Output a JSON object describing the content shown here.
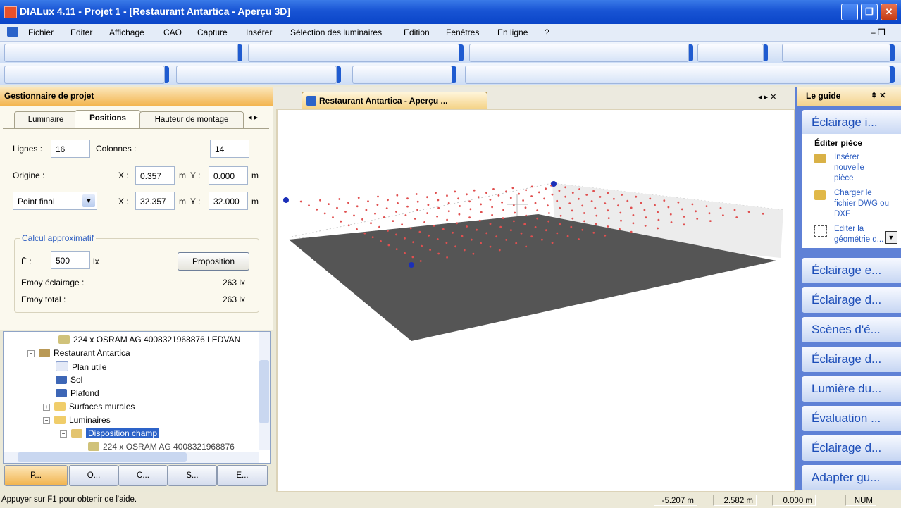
{
  "window": {
    "title": "DIALux 4.11 - Projet 1 - [Restaurant Antartica - Aperçu 3D]",
    "buttons": {
      "minimize": "_",
      "restore": "❐",
      "close": "✕"
    }
  },
  "menu": {
    "items": [
      "Fichier",
      "Editer",
      "Affichage",
      "CAO",
      "Capture",
      "Insérer",
      "Sélection des luminaires",
      "Edition",
      "Fenêtres",
      "En ligne",
      "?"
    ],
    "mdi_controls": "– ❐"
  },
  "project_manager": {
    "title": "Gestionnaire de projet",
    "tabs": [
      "Luminaire",
      "Positions",
      "Hauteur de montage"
    ],
    "active_tab": "Positions",
    "rows_label": "Lignes :",
    "rows_value": "16",
    "cols_label": "Colonnes :",
    "cols_value": "14",
    "origin_label": "Origine :",
    "x_label": "X :",
    "y_label": "Y :",
    "unit_m": "m",
    "origin_x": "0.357",
    "origin_y": "0.000",
    "endpoint_select": "Point final",
    "end_x": "32.357",
    "end_y": "32.000",
    "calc_group_label": "Calcul approximatif",
    "e_label": "Ē :",
    "e_value": "500",
    "e_unit": "lx",
    "proposal_button": "Proposition",
    "emoy_lighting_label": "Emoy éclairage :",
    "emoy_lighting_value": "263 lx",
    "emoy_total_label": "Emoy total :",
    "emoy_total_value": "263 lx"
  },
  "tree": {
    "items": [
      "224 x OSRAM AG 4008321968876 LEDVAN",
      "Restaurant Antartica",
      "Plan utile",
      "Sol",
      "Plafond",
      "Surfaces murales",
      "Luminaires",
      "Disposition champ",
      "224 x OSRAM AG 4008321968876"
    ]
  },
  "bottom_tabs": [
    "P...",
    "O...",
    "C...",
    "S...",
    "E..."
  ],
  "viewport": {
    "tab_title": "Restaurant Antartica - Aperçu ...",
    "controls": "◂ ▸ ✕"
  },
  "guide": {
    "title": "Le guide",
    "controls": "⇞ ✕",
    "top_button": "Éclairage i...",
    "section_title": "Éditer pièce",
    "actions": [
      "Insérer nouvelle pièce",
      "Charger le fichier DWG ou DXF",
      "Editer la géométrie d..."
    ],
    "buttons": [
      "Éclairage e...",
      "Éclairage d...",
      "Scènes d'é...",
      "Éclairage d...",
      "Lumière du...",
      "Évaluation ...",
      "Éclairage d...",
      "Adapter gu..."
    ]
  },
  "status": {
    "help": "Appuyer sur F1 pour obtenir de l'aide.",
    "x": "-5.207 m",
    "y": "2.582 m",
    "z": "0.000 m",
    "num": "NUM"
  },
  "colors": {
    "titlebar": "#1854d4",
    "panel_header": "#f3b550",
    "guide_bg": "#5f81d6",
    "floor": "#555555",
    "luminaire_dot": "#e05050"
  }
}
